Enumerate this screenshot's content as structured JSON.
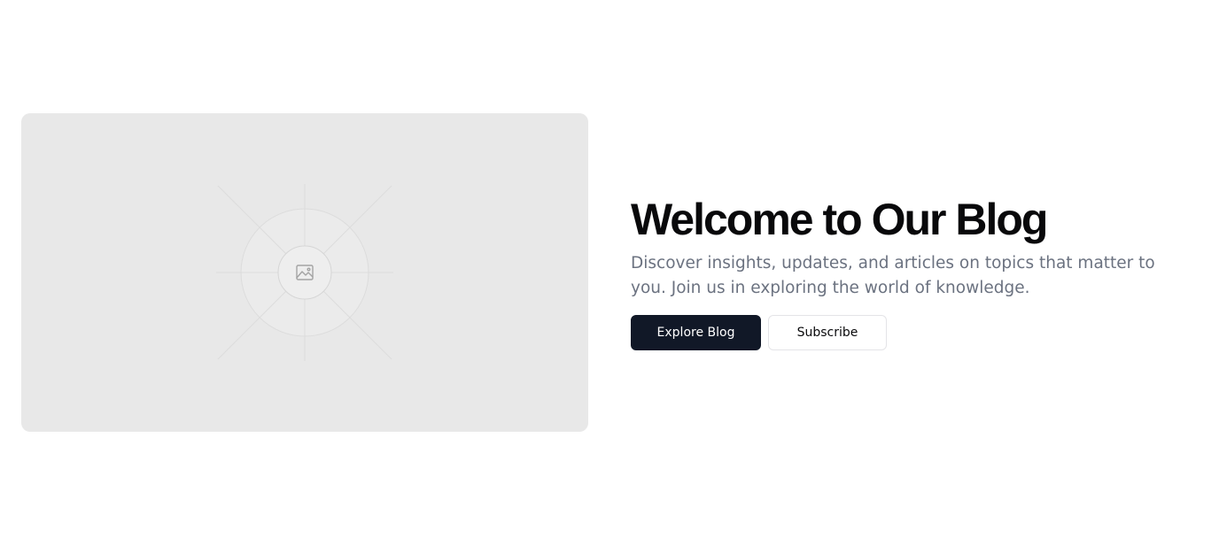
{
  "hero": {
    "image": {
      "icon": "image-icon"
    },
    "title": "Welcome to Our Blog",
    "subtitle": "Discover insights, updates, and articles on topics that matter to you. Join us in exploring the world of knowledge.",
    "primary_button_label": "Explore Blog",
    "secondary_button_label": "Subscribe"
  },
  "colors": {
    "primary_button_bg": "#111827",
    "placeholder_bg": "#e8e8e8",
    "subtitle_text": "#6b7280"
  }
}
